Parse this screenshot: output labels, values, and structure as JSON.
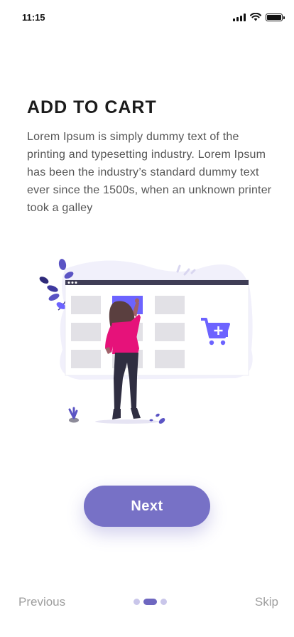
{
  "status_bar": {
    "time": "11:15",
    "battery_level": 1.0
  },
  "onboarding": {
    "title": "ADD TO CART",
    "description": "Lorem Ipsum is simply dummy text of the printing and typesetting industry. Lorem Ipsum has been the industry’s standard dummy text ever since the 1500s, when an unknown printer took a galley",
    "illustration": "shopping-cart-woman-illustration",
    "next_label": "Next"
  },
  "footer": {
    "previous_label": "Previous",
    "skip_label": "Skip",
    "page_count": 3,
    "current_page": 2
  },
  "colors": {
    "accent": "#7771c6",
    "accent_dark": "#6c63ff",
    "text_dark": "#1b1b1b",
    "text_muted": "#9e9e9e",
    "dot_inactive": "#c9c6ea"
  }
}
